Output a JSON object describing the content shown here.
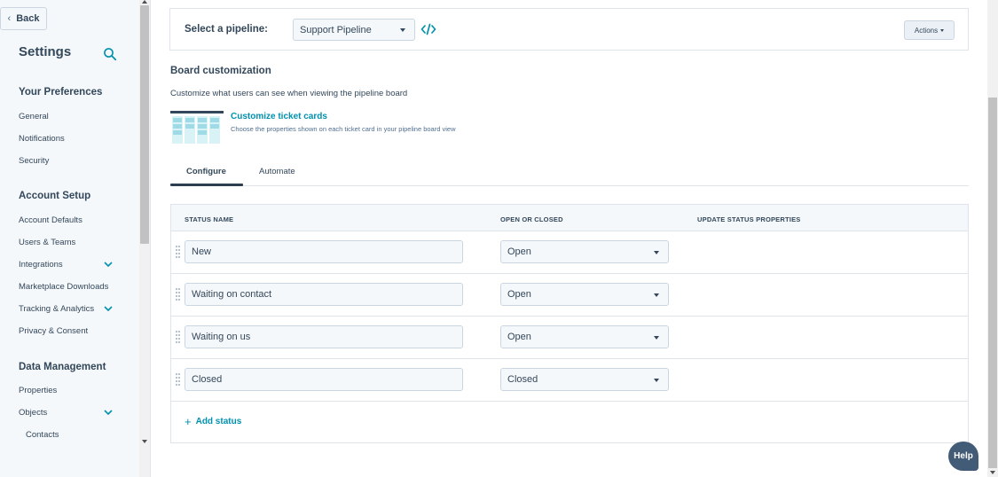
{
  "sidebar": {
    "back_label": "Back",
    "title": "Settings",
    "search_icon": "search-icon",
    "groups": [
      {
        "title": "Your Preferences",
        "items": [
          {
            "label": "General"
          },
          {
            "label": "Notifications"
          },
          {
            "label": "Security"
          }
        ]
      },
      {
        "title": "Account Setup",
        "items": [
          {
            "label": "Account Defaults"
          },
          {
            "label": "Users & Teams"
          },
          {
            "label": "Integrations",
            "expandable": true
          },
          {
            "label": "Marketplace Downloads"
          },
          {
            "label": "Tracking & Analytics",
            "expandable": true
          },
          {
            "label": "Privacy & Consent"
          }
        ]
      },
      {
        "title": "Data Management",
        "items": [
          {
            "label": "Properties"
          },
          {
            "label": "Objects",
            "expandable": true
          },
          {
            "label": "Contacts",
            "indent": true
          }
        ]
      }
    ]
  },
  "pipeline": {
    "label": "Select a pipeline:",
    "selected": "Support Pipeline",
    "actions_label": "Actions"
  },
  "board": {
    "title": "Board customization",
    "description": "Customize what users can see when viewing the pipeline board",
    "link_label": "Customize ticket cards",
    "link_description": "Choose the properties shown on each ticket card in your pipeline board view"
  },
  "tabs": [
    {
      "label": "Configure",
      "active": true
    },
    {
      "label": "Automate",
      "active": false
    }
  ],
  "table": {
    "headers": [
      "STATUS NAME",
      "OPEN OR CLOSED",
      "UPDATE STATUS PROPERTIES"
    ],
    "rows": [
      {
        "name": "New",
        "state": "Open"
      },
      {
        "name": "Waiting on contact",
        "state": "Open"
      },
      {
        "name": "Waiting on us",
        "state": "Open"
      },
      {
        "name": "Closed",
        "state": "Closed"
      }
    ],
    "add_label": "Add status"
  },
  "help_label": "Help",
  "colors": {
    "accent": "#0091ae",
    "text": "#33475b",
    "sidebar_bg": "#f5f8fa",
    "help_bg": "#425b76"
  }
}
